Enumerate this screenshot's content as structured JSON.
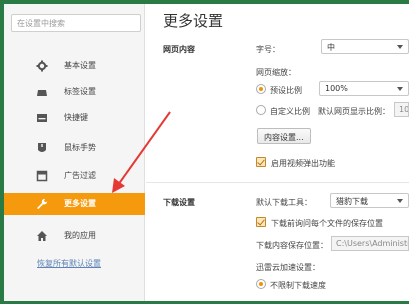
{
  "sidebar": {
    "search_placeholder": "在设置中搜索",
    "items": [
      {
        "label": "基本设置",
        "icon": "gear-icon"
      },
      {
        "label": "标签设置",
        "icon": "tab-icon"
      },
      {
        "label": "快捷键",
        "icon": "keyboard-icon"
      },
      {
        "label": "鼠标手势",
        "icon": "mouse-icon"
      },
      {
        "label": "广告过滤",
        "icon": "filter-icon"
      },
      {
        "label": "更多设置",
        "icon": "wrench-icon"
      },
      {
        "label": "我的应用",
        "icon": "home-icon"
      }
    ],
    "restore_link": "恢复所有默认设置"
  },
  "main": {
    "title": "更多设置",
    "web_content": {
      "label": "网页内容",
      "font_size_label": "字号：",
      "font_size_value": "中",
      "zoom_label": "网页缩放：",
      "preset_label": "预设比例",
      "preset_value": "100%",
      "custom_label": "自定义比例",
      "default_zoom_label": "默认网页显示比例：",
      "default_zoom_value": "100",
      "content_settings_button": "内容设置...",
      "video_popup_label": "启用视频弹出功能"
    },
    "download": {
      "label": "下载设置",
      "default_tool_label": "默认下载工具：",
      "default_tool_value": "猎豹下载",
      "ask_save_label": "下载前询问每个文件的保存位置",
      "save_location_label": "下载内容保存位置：",
      "save_location_value": "C:\\Users\\Administra",
      "cloud_label": "迅雷云加速设置：",
      "no_limit_label": "不限制下载速度"
    }
  },
  "colors": {
    "active_item": "#f59a0c",
    "annotation_arrow": "#e53935",
    "frame": "#2a7a45"
  }
}
